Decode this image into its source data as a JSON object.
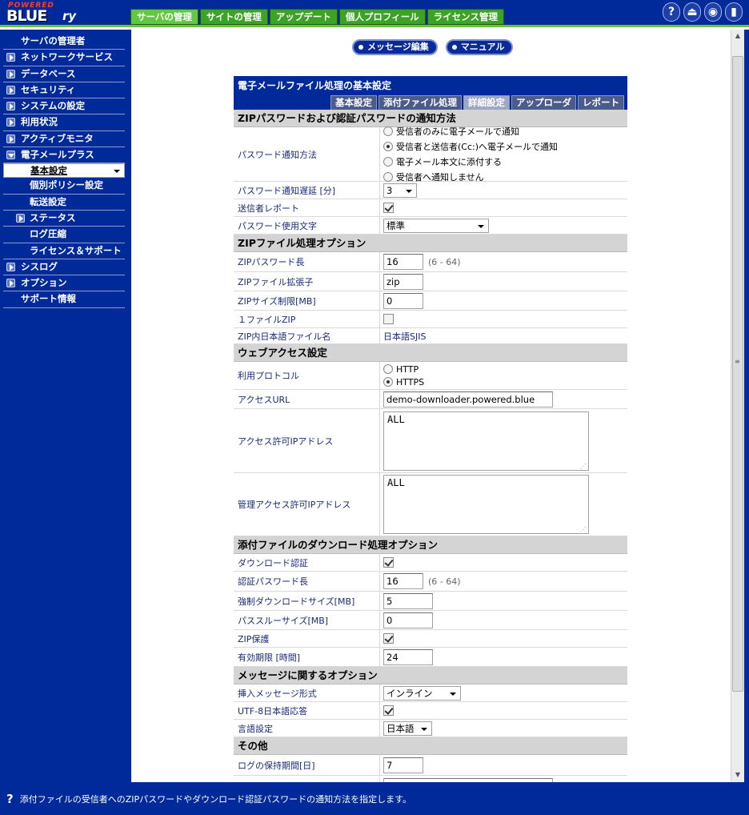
{
  "logo": {
    "powered": "POWERED",
    "blue": "BLUE",
    "ry": "ry"
  },
  "top_tabs": [
    "サーバの管理",
    "サイトの管理",
    "アップデート",
    "個人プロフィール",
    "ライセンス管理"
  ],
  "top_icons": {
    "help": "?",
    "logout": "⏏",
    "view": "◉",
    "exit": "▮"
  },
  "sidebar": [
    {
      "label": "サーバの管理者",
      "tri": "none",
      "sub": false
    },
    {
      "label": "ネットワークサービス",
      "tri": "closed",
      "sub": false
    },
    {
      "label": "データベース",
      "tri": "closed",
      "sub": false
    },
    {
      "label": "セキュリティ",
      "tri": "closed",
      "sub": false
    },
    {
      "label": "システムの設定",
      "tri": "closed",
      "sub": false
    },
    {
      "label": "利用状況",
      "tri": "closed",
      "sub": false
    },
    {
      "label": "アクティブモニタ",
      "tri": "closed",
      "sub": false
    },
    {
      "label": "電子メールプラス",
      "tri": "open",
      "sub": false
    },
    {
      "label": "基本設定",
      "tri": "none",
      "sub": true,
      "selected": true
    },
    {
      "label": "個別ポリシー設定",
      "tri": "none",
      "sub": true
    },
    {
      "label": "転送設定",
      "tri": "none",
      "sub": true
    },
    {
      "label": "ステータス",
      "tri": "closed",
      "sub": true
    },
    {
      "label": "ログ圧縮",
      "tri": "none",
      "sub": true
    },
    {
      "label": "ライセンス＆サポート",
      "tri": "none",
      "sub": true
    },
    {
      "label": "シスログ",
      "tri": "closed",
      "sub": false
    },
    {
      "label": "オプション",
      "tri": "closed",
      "sub": false
    },
    {
      "label": "サポート情報",
      "tri": "none",
      "sub": false
    }
  ],
  "page_buttons": {
    "message_edit": "メッセージ編集",
    "manual": "マニュアル"
  },
  "panel": {
    "title": "電子メールファイル処理の基本設定",
    "tabs": [
      "基本設定",
      "添付ファイル処理",
      "詳細設定",
      "アップローダ",
      "レポート"
    ],
    "active_tab": 2
  },
  "sections": {
    "s1": {
      "title": "ZIPパスワードおよび認証パスワードの通知方法",
      "notify_method_label": "パスワード通知方法",
      "notify_options": [
        "受信者のみに電子メールで通知",
        "受信者と送信者(Cc:)へ電子メールで通知",
        "電子メール本文に添付する",
        "受信者へ通知しません"
      ],
      "notify_selected": 1,
      "delay_label": "パスワード通知遅延 [分]",
      "delay_value": "3",
      "sender_report_label": "送信者レポート",
      "chars_label": "パスワード使用文字",
      "chars_value": "標準"
    },
    "s2": {
      "title": "ZIPファイル処理オプション",
      "zip_pw_len_label": "ZIPパスワード長",
      "zip_pw_len_value": "16",
      "zip_pw_len_hint": "(6 - 64)",
      "zip_ext_label": "ZIPファイル拡張子",
      "zip_ext_value": "zip",
      "zip_size_label": "ZIPサイズ制限[MB]",
      "zip_size_value": "0",
      "one_file_label": "１ファイルZIP",
      "jp_name_label": "ZIP内日本語ファイル名",
      "jp_name_value": "日本語SJIS"
    },
    "s3": {
      "title": "ウェブアクセス設定",
      "protocol_label": "利用プロトコル",
      "protocol_options": [
        "HTTP",
        "HTTPS"
      ],
      "protocol_selected": 1,
      "url_label": "アクセスURL",
      "url_value": "demo-downloader.powered.blue",
      "ip_label": "アクセス許可IPアドレス",
      "ip_value": "ALL",
      "admin_ip_label": "管理アクセス許可IPアドレス",
      "admin_ip_value": "ALL"
    },
    "s4": {
      "title": "添付ファイルのダウンロード処理オプション",
      "dl_auth_label": "ダウンロード認証",
      "auth_pw_len_label": "認証パスワード長",
      "auth_pw_len_value": "16",
      "auth_pw_len_hint": "(6 - 64)",
      "force_size_label": "強制ダウンロードサイズ[MB]",
      "force_size_value": "5",
      "pass_size_label": "パススルーサイズ[MB]",
      "pass_size_value": "0",
      "zip_protect_label": "ZIP保護",
      "expiry_label": "有効期限 [時間]",
      "expiry_value": "24"
    },
    "s5": {
      "title": "メッセージに関するオプション",
      "insert_label": "挿入メッセージ形式",
      "insert_value": "インライン",
      "utf8_label": "UTF-8日本語応答",
      "lang_label": "言語設定",
      "lang_value": "日本語"
    },
    "s6": {
      "title": "その他",
      "log_label": "ログの保持期間[日]",
      "log_value": "7"
    }
  },
  "status": {
    "icon": "?",
    "text": "添付ファイルの受信者へのZIPパスワードやダウンロード認証パスワードの通知方法を指定します。"
  }
}
